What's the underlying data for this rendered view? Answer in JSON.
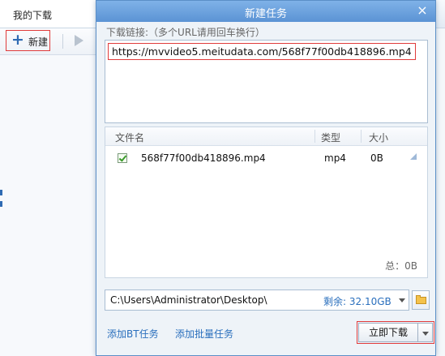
{
  "background": {
    "tab_label": "我的下载",
    "new_button_label": "新建"
  },
  "dialog": {
    "title": "新建任务",
    "url_label": "下载链接:（多个URL请用回车换行）",
    "url_value": "https://mvvideo5.meitudata.com/568f77f00db418896.mp4",
    "columns": {
      "name": "文件名",
      "type": "类型",
      "size": "大小"
    },
    "files": [
      {
        "name": "568f77f00db418896.mp4",
        "type": "mp4",
        "size": "0B",
        "checked": true
      }
    ],
    "total": "总：0B",
    "save_path": "C:\\Users\\Administrator\\Desktop\\",
    "free_space": "剩余: 32.10GB",
    "link_bt": "添加BT任务",
    "link_batch": "添加批量任务",
    "download_button": "立即下载"
  },
  "icons": {
    "new": "plus-icon",
    "start": "play-icon",
    "close": "close-icon",
    "folder": "folder-icon",
    "dropdown": "chevron-down-icon"
  },
  "colors": {
    "title_bar": "#5b93d4",
    "link": "#2a6fbd",
    "highlight_border": "#e03b3b"
  }
}
